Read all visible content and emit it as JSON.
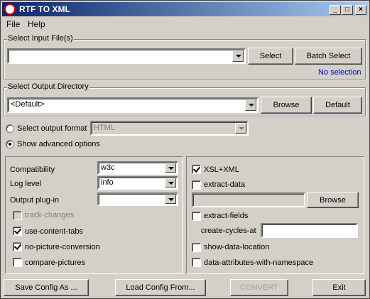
{
  "window": {
    "title": "RTF TO XML"
  },
  "menu": [
    "File",
    "Help"
  ],
  "input": {
    "group_title": "Select Input File(s)",
    "value": "",
    "select_label": "Select",
    "batch_label": "Batch Select",
    "status": "No selection"
  },
  "output": {
    "group_title": "Select Output Directory",
    "value": "<Default>",
    "browse_label": "Browse",
    "default_label": "Default"
  },
  "format": {
    "label": "Select output format",
    "value": "HTML",
    "selected": false
  },
  "advanced": {
    "label": "Show advanced options",
    "selected": true
  },
  "left_panel": {
    "compat_label": "Compatibility",
    "compat_value": "w3c",
    "log_label": "Log level",
    "log_value": "info",
    "plugin_label": "Output plug-in",
    "plugin_value": "",
    "checks": [
      {
        "label": "track-changes",
        "checked": false,
        "disabled": true
      },
      {
        "label": "use-content-tabs",
        "checked": true,
        "disabled": false
      },
      {
        "label": "no-picture-conversion",
        "checked": true,
        "disabled": false
      },
      {
        "label": "compare-pictures",
        "checked": false,
        "disabled": false
      }
    ]
  },
  "right_panel": {
    "xsl_label": "XSL+XML",
    "extract_data_label": "extract-data",
    "extract_data_value": "",
    "browse_label": "Browse",
    "extract_fields_label": "extract-fields",
    "cycles_label": "create-cycles-at",
    "cycles_value": "",
    "show_loc_label": "show-data-location",
    "ns_label": "data-attributes-with-namespace"
  },
  "footer": {
    "save_label": "Save Config As ...",
    "load_label": "Load Config From...",
    "convert_label": "CONVERT",
    "exit_label": "Exit"
  }
}
